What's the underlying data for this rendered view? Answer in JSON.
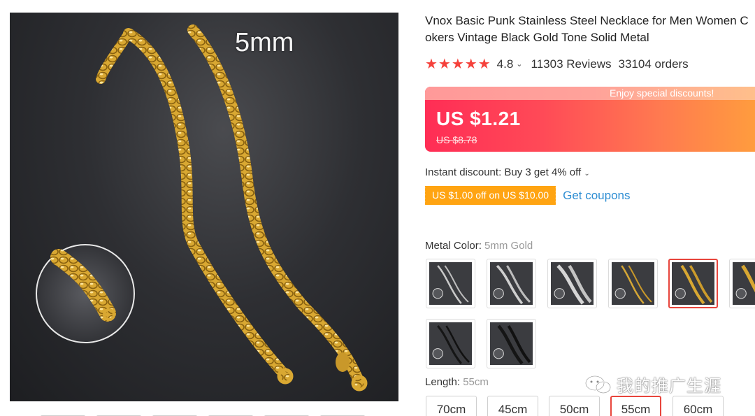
{
  "product": {
    "title_line1": "Vnox Basic Punk Stainless Steel Necklace for Men Women C",
    "title_line2": "okers Vintage Black Gold Tone Solid Metal",
    "image_size_label": "5mm"
  },
  "rating": {
    "stars": "★★★★★",
    "score": "4.8",
    "reviews": "11303 Reviews",
    "orders": "33104 orders"
  },
  "price": {
    "promo_text": "Enjoy special discounts!",
    "current": "US $1.21",
    "original": "US $8.78"
  },
  "discount": {
    "instant_text": "Instant discount: Buy 3 get 4% off",
    "coupon_tag": "US $1.00 off on US $10.00",
    "get_coupons": "Get coupons"
  },
  "metal_color": {
    "label": "Metal Color:",
    "selected": "5mm Gold",
    "options": [
      {
        "name": "silver-thin",
        "selected": false
      },
      {
        "name": "silver-medium",
        "selected": false
      },
      {
        "name": "silver-thick",
        "selected": false
      },
      {
        "name": "gold-thin",
        "selected": false
      },
      {
        "name": "gold-5mm",
        "selected": true
      },
      {
        "name": "gold-partial",
        "selected": false
      },
      {
        "name": "black-thin",
        "selected": false
      },
      {
        "name": "black-medium",
        "selected": false
      }
    ]
  },
  "length": {
    "label": "Length:",
    "selected": "55cm",
    "options": [
      "70cm",
      "45cm",
      "50cm",
      "55cm",
      "60cm"
    ]
  },
  "watermark": {
    "text": "我的推广生涯"
  },
  "colors": {
    "accent_red": "#e8453c",
    "star_red": "#f5413b",
    "coupon_orange": "#ffa412",
    "link_blue": "#2e8ed3"
  }
}
